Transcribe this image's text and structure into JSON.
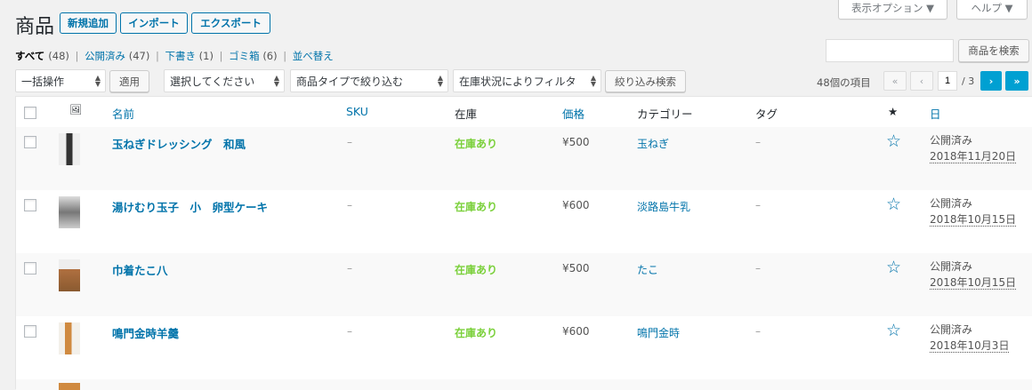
{
  "header": {
    "title": "商品",
    "add_new": "新規追加",
    "import": "インポート",
    "export": "エクスポート",
    "screen_options": "表示オプション ▼",
    "help": "ヘルプ ▼"
  },
  "subsubsub": {
    "all_label": "すべて",
    "all_count": "(48)",
    "published_label": "公開済み",
    "published_count": "(47)",
    "draft_label": "下書き",
    "draft_count": "(1)",
    "trash_label": "ゴミ箱",
    "trash_count": "(6)",
    "sort_label": "並べ替え",
    "sep": "|"
  },
  "search": {
    "value": "",
    "button": "商品を検索"
  },
  "filters": {
    "bulk_action": "一括操作",
    "apply": "適用",
    "category": "選択してください",
    "product_type": "商品タイプで絞り込む",
    "stock_status": "在庫状況によりフィルタ",
    "filter_button": "絞り込み検索"
  },
  "pagination": {
    "items_count": "48個の項目",
    "first": "«",
    "prev": "‹",
    "current_page": "1",
    "total_pages": "/ 3",
    "next": "›",
    "last": "»"
  },
  "columns": {
    "image": "🖼",
    "name": "名前",
    "sku": "SKU",
    "stock": "在庫",
    "price": "価格",
    "categories": "カテゴリー",
    "tags": "タグ",
    "featured": "★",
    "date": "日"
  },
  "rows": [
    {
      "name": "玉ねぎドレッシング　和風",
      "sku": "–",
      "stock": "在庫あり",
      "price": "¥500",
      "category": "玉ねぎ",
      "tags": "–",
      "featured": "☆",
      "status": "公開済み",
      "date": "2018年11月20日"
    },
    {
      "name": "湯けむり玉子　小　卵型ケーキ",
      "sku": "–",
      "stock": "在庫あり",
      "price": "¥600",
      "category": "淡路島牛乳",
      "tags": "–",
      "featured": "☆",
      "status": "公開済み",
      "date": "2018年10月15日"
    },
    {
      "name": "巾着たこ八",
      "sku": "–",
      "stock": "在庫あり",
      "price": "¥500",
      "category": "たこ",
      "tags": "–",
      "featured": "☆",
      "status": "公開済み",
      "date": "2018年10月15日"
    },
    {
      "name": "鳴門金時羊羹",
      "sku": "–",
      "stock": "在庫あり",
      "price": "¥600",
      "category": "鳴門金時",
      "tags": "–",
      "featured": "☆",
      "status": "公開済み",
      "date": "2018年10月3日"
    }
  ],
  "colors": {
    "link": "#0073aa",
    "in_stock": "#7ad03a",
    "page_bg": "#f1f1f1",
    "active_page": "#00a0d2"
  }
}
